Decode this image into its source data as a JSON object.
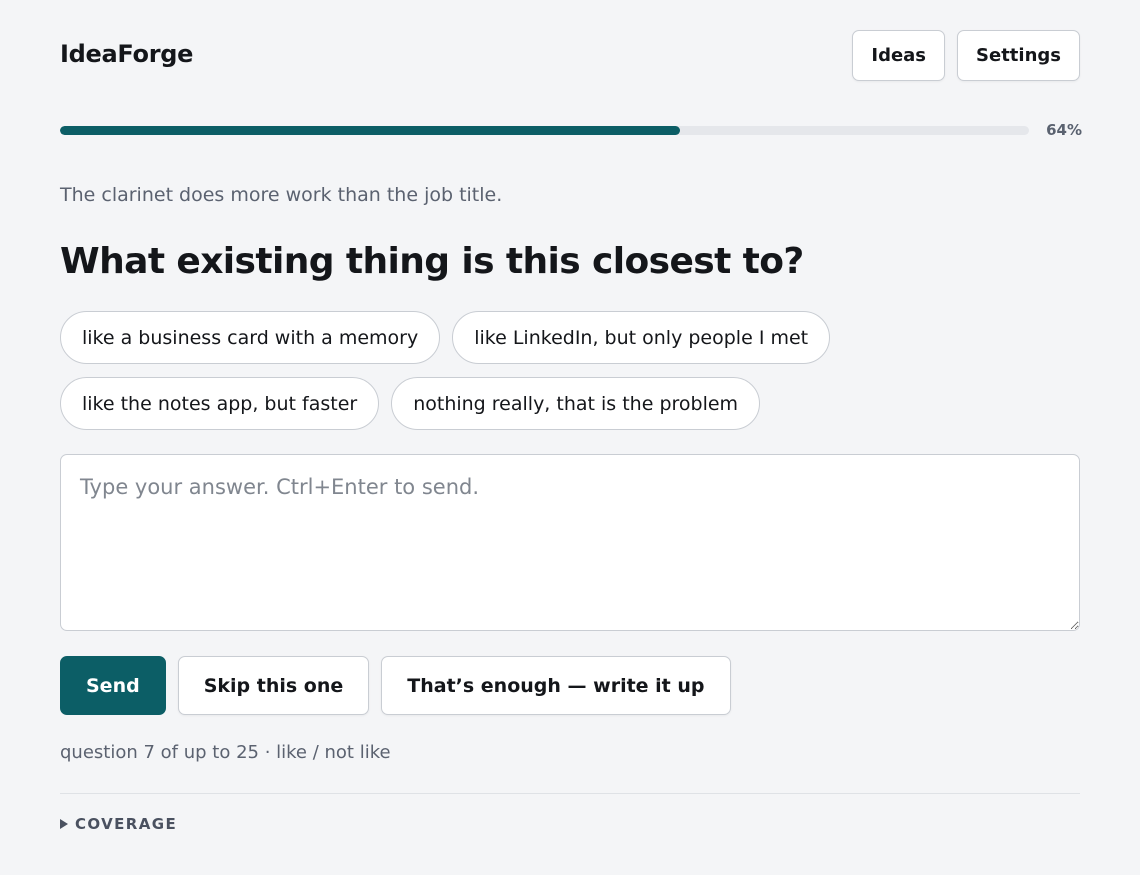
{
  "app": {
    "title": "IdeaForge"
  },
  "nav": {
    "ideas_label": "Ideas",
    "settings_label": "Settings"
  },
  "progress": {
    "value": 0.64,
    "label": "64%"
  },
  "context": {
    "text": "The clarinet does more work than the job title."
  },
  "question": {
    "text": "What existing thing is this closest to?"
  },
  "suggestions": [
    "like a business card with a memory",
    "like LinkedIn, but only people I met",
    "like the notes app, but faster",
    "nothing really, that is the problem"
  ],
  "answer": {
    "value": "",
    "placeholder": "Type your answer. Ctrl+Enter to send."
  },
  "actions": {
    "send_label": "Send",
    "skip_label": "Skip this one",
    "finish_label": "That’s enough — write it up"
  },
  "status": {
    "text": "question 7 of up to 25 · like / not like"
  },
  "coverage": {
    "label": "COVERAGE"
  },
  "colors": {
    "accent": "#0c5e66",
    "background": "#f4f5f7",
    "track": "#e5e7eb",
    "muted_text": "#5b6270"
  },
  "icons": {
    "coverage_toggle": "caret-right-icon"
  }
}
